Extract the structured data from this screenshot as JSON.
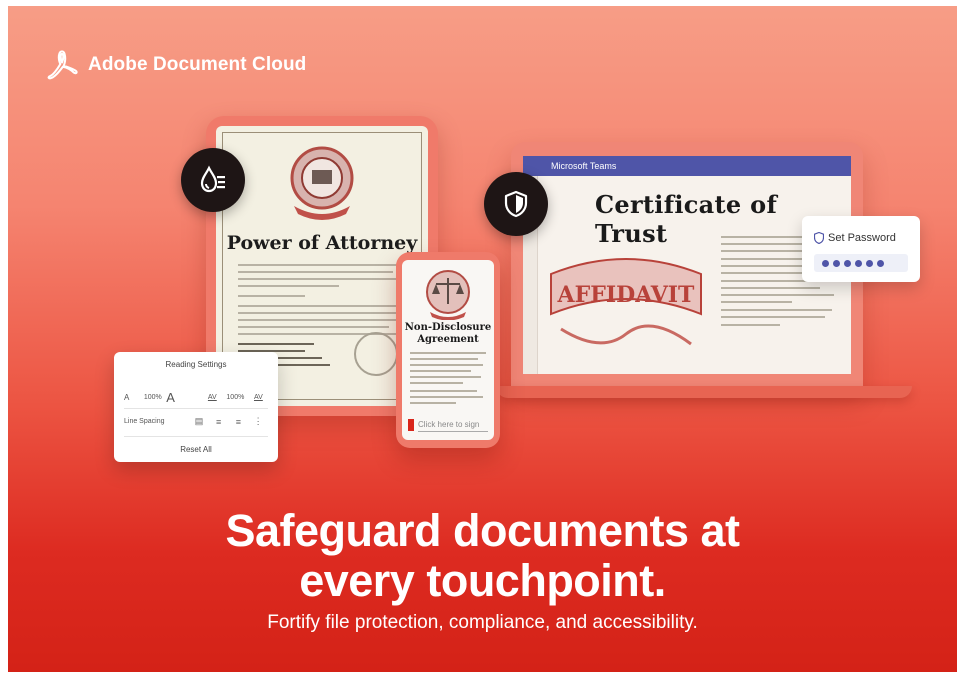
{
  "brand": {
    "name": "Adobe Document Cloud"
  },
  "tablet": {
    "document_title": "Power of Attorney"
  },
  "laptop": {
    "app_bar": "Microsoft Teams",
    "document_title": "Certificate of Trust",
    "banner_text": "AFFIDAVIT"
  },
  "password_card": {
    "label": "Set Password",
    "dots": 6
  },
  "phone": {
    "document_title_line1": "Non-Disclosure",
    "document_title_line2": "Agreement",
    "sign_placeholder": "Click here to sign"
  },
  "reading_settings": {
    "title": "Reading Settings",
    "font_small": "A",
    "font_size_pct": "100%",
    "font_large": "A",
    "char_spacing_icon": "AV",
    "char_spacing_pct": "100%",
    "word_spacing_icon": "AV",
    "line_spacing_label": "Line Spacing",
    "reset_label": "Reset All"
  },
  "headline": {
    "line1": "Safeguard documents at",
    "line2": "every touchpoint."
  },
  "subline": "Fortify file protection, compliance, and accessibility.",
  "colors": {
    "accent_red": "#dd2b21",
    "teams_purple": "#4f55a8",
    "badge_dark": "#1e1515"
  },
  "icons": {
    "brand": "acrobat-logo-icon",
    "badge_left": "watermark-drop-icon",
    "badge_right": "shield-icon"
  }
}
